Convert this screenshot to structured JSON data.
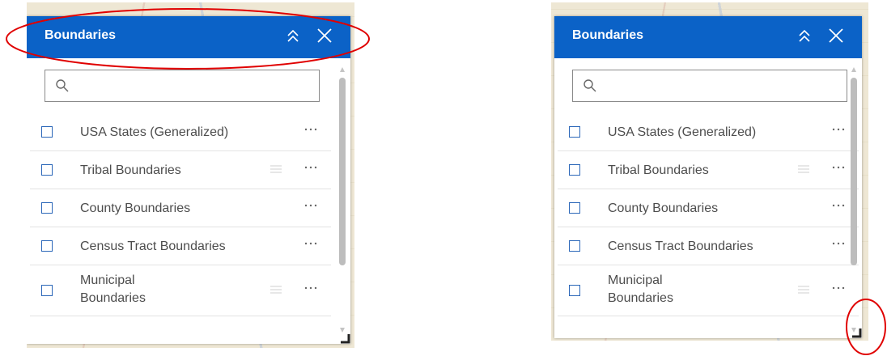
{
  "panels": [
    {
      "title": "Boundaries",
      "search": {
        "placeholder": "",
        "value": ""
      },
      "layers": [
        {
          "label": "USA States (Generalized)",
          "checked": false,
          "draggable": false
        },
        {
          "label": "Tribal Boundaries",
          "checked": false,
          "draggable": true
        },
        {
          "label": "County Boundaries",
          "checked": false,
          "draggable": false
        },
        {
          "label": "Census Tract Boundaries",
          "checked": false,
          "draggable": false
        },
        {
          "label": "Municipal\nBoundaries",
          "checked": false,
          "draggable": true
        }
      ],
      "annotation": "header-ellipse"
    },
    {
      "title": "Boundaries",
      "search": {
        "placeholder": "",
        "value": ""
      },
      "layers": [
        {
          "label": "USA States (Generalized)",
          "checked": false,
          "draggable": false
        },
        {
          "label": "Tribal Boundaries",
          "checked": false,
          "draggable": true
        },
        {
          "label": "County Boundaries",
          "checked": false,
          "draggable": false
        },
        {
          "label": "Census Tract Boundaries",
          "checked": false,
          "draggable": false
        },
        {
          "label": "Municipal\nBoundaries",
          "checked": false,
          "draggable": true
        }
      ],
      "annotation": "resize-handle-circle"
    }
  ],
  "colors": {
    "header": "#0b62c7",
    "checkbox": "#2a66b8",
    "annotation": "#e00000"
  },
  "icons": [
    "search-icon",
    "collapse-icon",
    "close-icon",
    "drag-handle-icon",
    "more-options-icon",
    "resize-handle-icon"
  ]
}
